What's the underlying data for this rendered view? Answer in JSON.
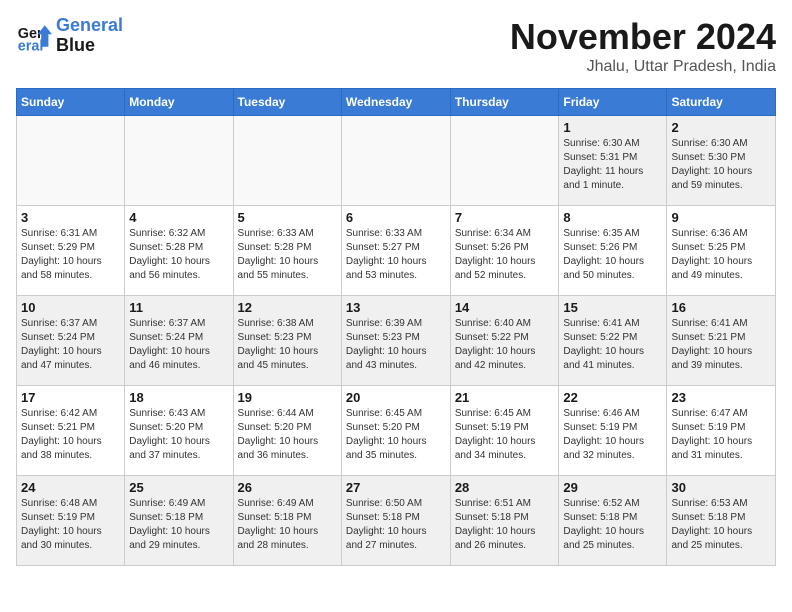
{
  "logo": {
    "line1": "General",
    "line2": "Blue"
  },
  "title": "November 2024",
  "location": "Jhalu, Uttar Pradesh, India",
  "weekdays": [
    "Sunday",
    "Monday",
    "Tuesday",
    "Wednesday",
    "Thursday",
    "Friday",
    "Saturday"
  ],
  "weeks": [
    [
      {
        "day": "",
        "info": ""
      },
      {
        "day": "",
        "info": ""
      },
      {
        "day": "",
        "info": ""
      },
      {
        "day": "",
        "info": ""
      },
      {
        "day": "",
        "info": ""
      },
      {
        "day": "1",
        "info": "Sunrise: 6:30 AM\nSunset: 5:31 PM\nDaylight: 11 hours\nand 1 minute."
      },
      {
        "day": "2",
        "info": "Sunrise: 6:30 AM\nSunset: 5:30 PM\nDaylight: 10 hours\nand 59 minutes."
      }
    ],
    [
      {
        "day": "3",
        "info": "Sunrise: 6:31 AM\nSunset: 5:29 PM\nDaylight: 10 hours\nand 58 minutes."
      },
      {
        "day": "4",
        "info": "Sunrise: 6:32 AM\nSunset: 5:28 PM\nDaylight: 10 hours\nand 56 minutes."
      },
      {
        "day": "5",
        "info": "Sunrise: 6:33 AM\nSunset: 5:28 PM\nDaylight: 10 hours\nand 55 minutes."
      },
      {
        "day": "6",
        "info": "Sunrise: 6:33 AM\nSunset: 5:27 PM\nDaylight: 10 hours\nand 53 minutes."
      },
      {
        "day": "7",
        "info": "Sunrise: 6:34 AM\nSunset: 5:26 PM\nDaylight: 10 hours\nand 52 minutes."
      },
      {
        "day": "8",
        "info": "Sunrise: 6:35 AM\nSunset: 5:26 PM\nDaylight: 10 hours\nand 50 minutes."
      },
      {
        "day": "9",
        "info": "Sunrise: 6:36 AM\nSunset: 5:25 PM\nDaylight: 10 hours\nand 49 minutes."
      }
    ],
    [
      {
        "day": "10",
        "info": "Sunrise: 6:37 AM\nSunset: 5:24 PM\nDaylight: 10 hours\nand 47 minutes."
      },
      {
        "day": "11",
        "info": "Sunrise: 6:37 AM\nSunset: 5:24 PM\nDaylight: 10 hours\nand 46 minutes."
      },
      {
        "day": "12",
        "info": "Sunrise: 6:38 AM\nSunset: 5:23 PM\nDaylight: 10 hours\nand 45 minutes."
      },
      {
        "day": "13",
        "info": "Sunrise: 6:39 AM\nSunset: 5:23 PM\nDaylight: 10 hours\nand 43 minutes."
      },
      {
        "day": "14",
        "info": "Sunrise: 6:40 AM\nSunset: 5:22 PM\nDaylight: 10 hours\nand 42 minutes."
      },
      {
        "day": "15",
        "info": "Sunrise: 6:41 AM\nSunset: 5:22 PM\nDaylight: 10 hours\nand 41 minutes."
      },
      {
        "day": "16",
        "info": "Sunrise: 6:41 AM\nSunset: 5:21 PM\nDaylight: 10 hours\nand 39 minutes."
      }
    ],
    [
      {
        "day": "17",
        "info": "Sunrise: 6:42 AM\nSunset: 5:21 PM\nDaylight: 10 hours\nand 38 minutes."
      },
      {
        "day": "18",
        "info": "Sunrise: 6:43 AM\nSunset: 5:20 PM\nDaylight: 10 hours\nand 37 minutes."
      },
      {
        "day": "19",
        "info": "Sunrise: 6:44 AM\nSunset: 5:20 PM\nDaylight: 10 hours\nand 36 minutes."
      },
      {
        "day": "20",
        "info": "Sunrise: 6:45 AM\nSunset: 5:20 PM\nDaylight: 10 hours\nand 35 minutes."
      },
      {
        "day": "21",
        "info": "Sunrise: 6:45 AM\nSunset: 5:19 PM\nDaylight: 10 hours\nand 34 minutes."
      },
      {
        "day": "22",
        "info": "Sunrise: 6:46 AM\nSunset: 5:19 PM\nDaylight: 10 hours\nand 32 minutes."
      },
      {
        "day": "23",
        "info": "Sunrise: 6:47 AM\nSunset: 5:19 PM\nDaylight: 10 hours\nand 31 minutes."
      }
    ],
    [
      {
        "day": "24",
        "info": "Sunrise: 6:48 AM\nSunset: 5:19 PM\nDaylight: 10 hours\nand 30 minutes."
      },
      {
        "day": "25",
        "info": "Sunrise: 6:49 AM\nSunset: 5:18 PM\nDaylight: 10 hours\nand 29 minutes."
      },
      {
        "day": "26",
        "info": "Sunrise: 6:49 AM\nSunset: 5:18 PM\nDaylight: 10 hours\nand 28 minutes."
      },
      {
        "day": "27",
        "info": "Sunrise: 6:50 AM\nSunset: 5:18 PM\nDaylight: 10 hours\nand 27 minutes."
      },
      {
        "day": "28",
        "info": "Sunrise: 6:51 AM\nSunset: 5:18 PM\nDaylight: 10 hours\nand 26 minutes."
      },
      {
        "day": "29",
        "info": "Sunrise: 6:52 AM\nSunset: 5:18 PM\nDaylight: 10 hours\nand 25 minutes."
      },
      {
        "day": "30",
        "info": "Sunrise: 6:53 AM\nSunset: 5:18 PM\nDaylight: 10 hours\nand 25 minutes."
      }
    ]
  ]
}
